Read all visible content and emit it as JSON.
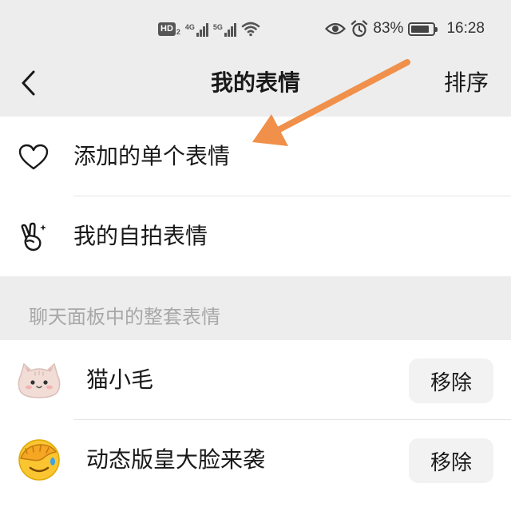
{
  "status_bar": {
    "hd_label": "HD",
    "hd_sub": "2",
    "sim1_label": "4G",
    "sim2_label": "5G",
    "battery_percent": "83%",
    "battery_level": 0.83,
    "time": "16:28",
    "icons": [
      "hd-icon",
      "signal-icon",
      "signal-icon",
      "wifi-icon",
      "eye-icon",
      "alarm-icon",
      "battery-icon"
    ]
  },
  "navbar": {
    "title": "我的表情",
    "sort_label": "排序",
    "back_icon": "chevron-left-icon"
  },
  "top_items": [
    {
      "label": "添加的单个表情",
      "icon": "heart-icon"
    },
    {
      "label": "我的自拍表情",
      "icon": "victory-hand-icon"
    }
  ],
  "section": {
    "header": "聊天面板中的整套表情"
  },
  "packs": [
    {
      "name": "猫小毛",
      "thumb": "cat-sticker-icon",
      "remove_label": "移除"
    },
    {
      "name": "动态版皇大脸来袭",
      "thumb": "facepalm-emoji-icon",
      "remove_label": "移除"
    }
  ],
  "colors": {
    "background": "#ededed",
    "card": "#ffffff",
    "annotation_arrow": "#f0904a",
    "secondary_text": "#a8a8a8",
    "button_bg": "#f2f2f2"
  }
}
